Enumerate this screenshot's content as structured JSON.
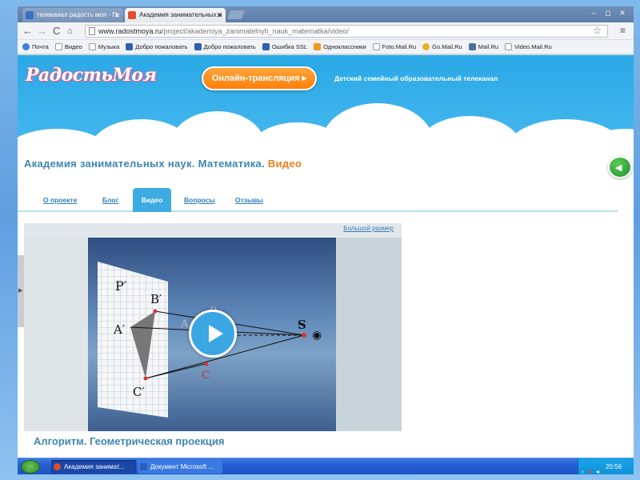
{
  "browser": {
    "tabs": [
      {
        "label": "телеканал радость моя - Гс",
        "icon_color": "#3a6fc7",
        "active": false
      },
      {
        "label": "Академия занимательных н",
        "icon_color": "#e24d2b",
        "active": true
      }
    ],
    "url_host": "www.radostmoya.ru",
    "url_path": "/project/akademiya_zanimatelnyh_nauk_matematka/video/",
    "bookmarks": [
      {
        "label": "Почта",
        "icon_color": "#3a7fd8"
      },
      {
        "label": "Видео",
        "icon_color": "#ffffff"
      },
      {
        "label": "Музыка",
        "icon_color": "#ffffff"
      },
      {
        "label": "Добро пожаловать",
        "icon_color": "#3060b0"
      },
      {
        "label": "Добро пожаловать",
        "icon_color": "#3060b0"
      },
      {
        "label": "Ошибка SSL",
        "icon_color": "#3060b0"
      },
      {
        "label": "Одноклассники",
        "icon_color": "#f29a1e"
      },
      {
        "label": "Foto.Mail.Ru",
        "icon_color": "#ffffff"
      },
      {
        "label": "Go.Mail.Ru",
        "icon_color": "#e6b428"
      },
      {
        "label": "Mail.Ru",
        "icon_color": "#4a6fa0"
      },
      {
        "label": "Video.Mail.Ru",
        "icon_color": "#ffffff"
      }
    ]
  },
  "site": {
    "logo_text": "РадостьМоя",
    "live_button": "Онлайн-трансляция ▸",
    "tagline": "Детский семейный образовательный телеканал",
    "title_main": "Академия занимательных наук. Математика.",
    "title_accent": "Видео",
    "nav": [
      "О проекте",
      "Блог",
      "Видео",
      "Вопросы",
      "Отзывы"
    ],
    "active_nav": "Видео",
    "bigger_link": "Большой размер",
    "video_title": "Алгоритм. Геометрическая проекция",
    "diagram_labels": {
      "p": "P′",
      "b": "B′",
      "a": "A′",
      "c": "C′",
      "s": "S",
      "b2": "B",
      "c2": "C",
      "a2": "A"
    }
  },
  "taskbar": {
    "tasks": [
      {
        "label": "Академия занимат...",
        "icon_color": "#e24d2b"
      },
      {
        "label": "Документ Microsoft ...",
        "icon_color": "#2b5fb8"
      }
    ],
    "clock": "20:56"
  },
  "colors": {
    "accent_blue": "#3c87b2",
    "accent_orange": "#f07d1a",
    "sky": "#2aa9e6"
  }
}
